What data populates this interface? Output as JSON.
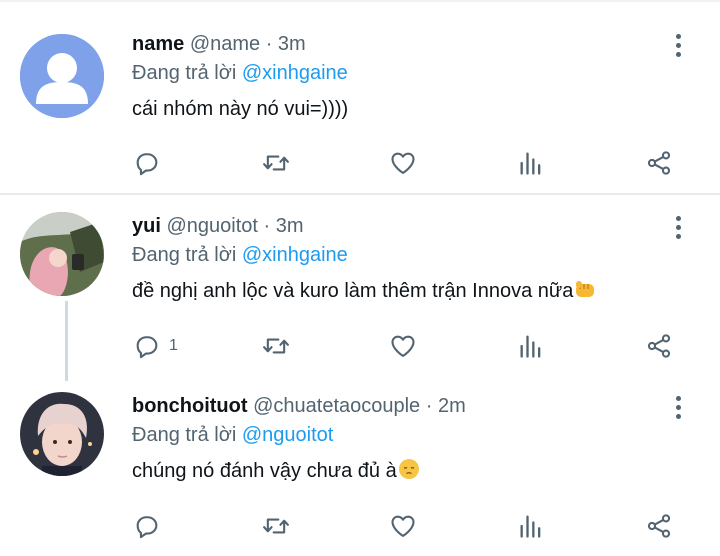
{
  "tweets": [
    {
      "name": "name",
      "handle": "@name",
      "time": "· 3m",
      "reply_prefix": "Đang trả lời",
      "reply_to": "@xinhgaine",
      "text": "cái nhóm này nó vui=))))",
      "reply_count": "",
      "avatar": "default-avatar"
    },
    {
      "name": "yui",
      "handle": "@nguoitot",
      "time": "· 3m",
      "reply_prefix": "Đang trả lời",
      "reply_to": "@xinhgaine",
      "text": "đề nghị anh lộc và kuro làm thêm trận Innova nữa",
      "text_emoji": "fist-emoji",
      "reply_count": "1",
      "avatar": "photo-avatar-pink-hair"
    },
    {
      "name": "bonchoituot",
      "handle": "@chuatetaocouple",
      "time": "· 2m",
      "reply_prefix": "Đang trả lời",
      "reply_to": "@nguoitot",
      "text": "chúng nó đánh vậy chưa đủ à",
      "text_emoji": "pensive-face-emoji",
      "reply_count": "",
      "avatar": "photo-avatar-blond-hair"
    }
  ],
  "colors": {
    "text": "#0f1419",
    "secondary": "#536471",
    "link": "#1d9bf0",
    "divider": "#e6ecf0"
  },
  "icons": [
    "reply-icon",
    "retweet-icon",
    "like-icon",
    "views-icon",
    "share-icon",
    "more-icon"
  ]
}
